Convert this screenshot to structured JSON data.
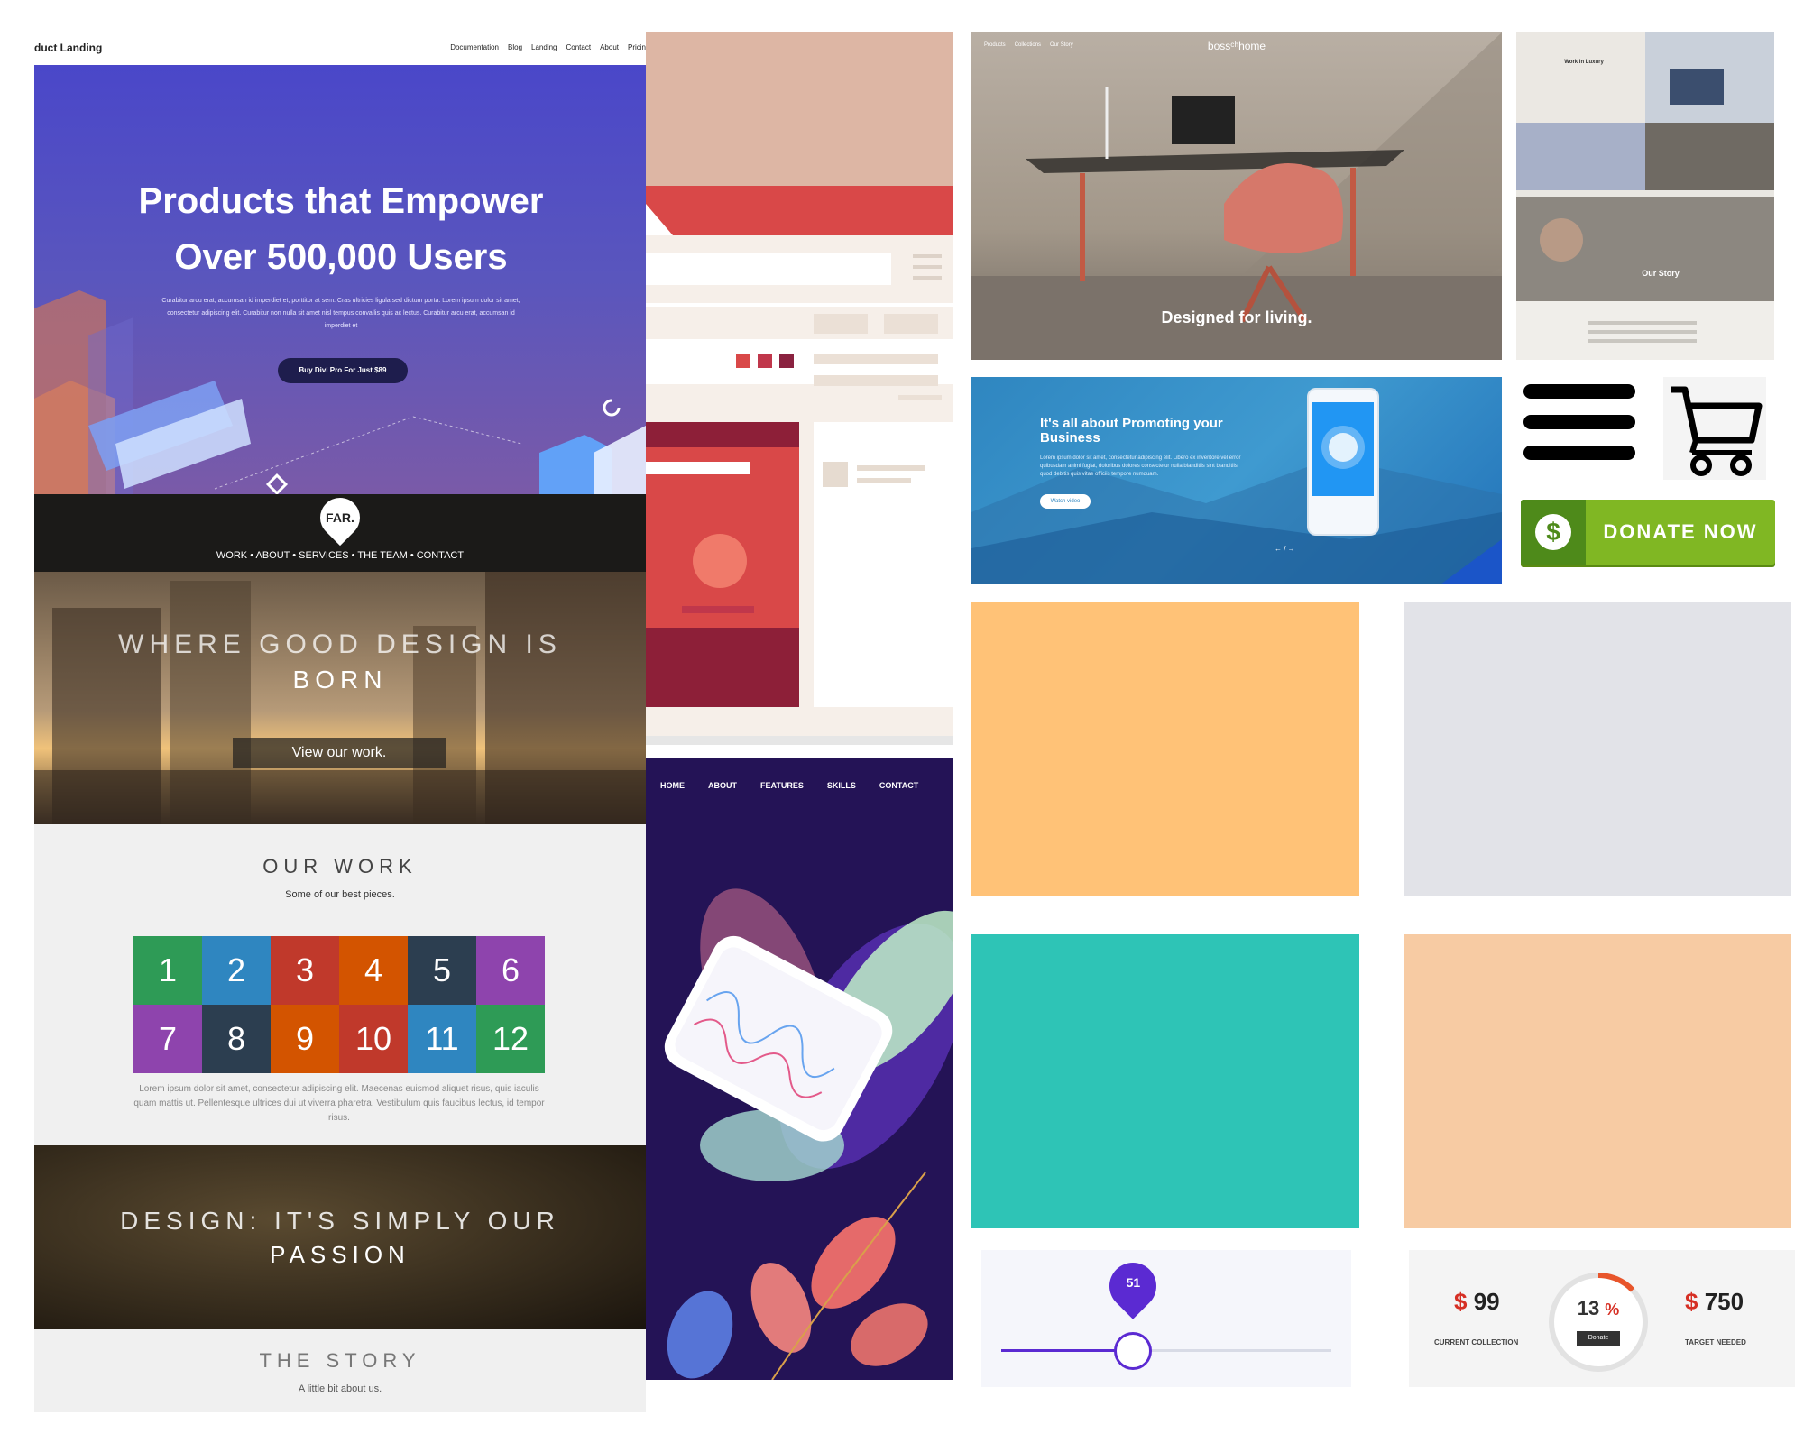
{
  "landing": {
    "brand": "duct Landing",
    "nav": [
      "Documentation",
      "Blog",
      "Landing",
      "Contact",
      "About",
      "Pricin"
    ],
    "headline_line1": "Products that Empower",
    "headline_line2": "Over 500,000 Users",
    "body": "Curabitur arcu erat, accumsan id imperdiet et, porttitor at sem. Cras ultricies ligula sed dictum porta. Lorem ipsum dolor sit amet, consectetur adipiscing elit. Curabitur non nulla sit amet nisl tempus convallis quis ac lectus. Curabitur arcu erat, accumsan id imperdiet et",
    "cta": "Buy Divi Pro For Just $89"
  },
  "far": {
    "logo": "FAR.",
    "menu": "WORK  •  ABOUT  •  SERVICES  •  THE TEAM  •  CONTACT",
    "hero_line1": "WHERE GOOD DESIGN IS",
    "hero_line2": "BORN",
    "view_button": "View our work.",
    "our_work": "OUR WORK",
    "our_work_sub": "Some of our best pieces.",
    "tiles": [
      {
        "n": "1",
        "color": "#2e9b56"
      },
      {
        "n": "2",
        "color": "#2f86c0"
      },
      {
        "n": "3",
        "color": "#c0392b"
      },
      {
        "n": "4",
        "color": "#d35400"
      },
      {
        "n": "5",
        "color": "#2c3e50"
      },
      {
        "n": "6",
        "color": "#8e44ad"
      },
      {
        "n": "7",
        "color": "#8e44ad"
      },
      {
        "n": "8",
        "color": "#2c3e50"
      },
      {
        "n": "9",
        "color": "#d35400"
      },
      {
        "n": "10",
        "color": "#c0392b"
      },
      {
        "n": "11",
        "color": "#2f86c0"
      },
      {
        "n": "12",
        "color": "#2e9b56"
      }
    ],
    "lorem": "Lorem ipsum dolor sit amet, consectetur adipiscing elit. Maecenas euismod aliquet risus, quis iaculis quam mattis ut. Pellentesque ultrices dui ut viverra pharetra. Vestibulum quis faucibus lectus, id tempor risus.",
    "design_line1": "DESIGN: IT'S SIMPLY OUR",
    "design_line2": "PASSION",
    "story": "THE STORY",
    "story_sub": "A little bit about us."
  },
  "app": {
    "nav": [
      "HOME",
      "ABOUT",
      "FEATURES",
      "SKILLS",
      "CONTACT"
    ]
  },
  "boss": {
    "logo": "bossᶜʰhome",
    "nav": [
      "Products",
      "Collections",
      "Our Story"
    ],
    "tagline": "Designed for living."
  },
  "luxury": {
    "heading": "Work in Luxury",
    "story": "Our Story"
  },
  "promo": {
    "title": "It's all about Promoting your Business",
    "body": "Lorem ipsum dolor sit amet, consectetur adipiscing elit. Libero ex inventore vel error quibusdam animi fugiat, doloribus dolores consectetur nulla blanditiis sint blanditiis quod debitis quis vitae officiis tempore numquam.",
    "button": "Watch video"
  },
  "donate": {
    "label": "DONATE NOW",
    "symbol": "$"
  },
  "swatches": {
    "orange": "#ffc277",
    "grey": "#e2e3e8",
    "teal": "#2ec4b6",
    "peach": "#f7cba3"
  },
  "slider": {
    "value": "51",
    "fraction": 0.4
  },
  "fund": {
    "current_symbol": "$",
    "current": "99",
    "current_label": "CURRENT COLLECTION",
    "percent": "13",
    "percent_symbol": "%",
    "donate": "Donate",
    "target_symbol": "$",
    "target": "750",
    "target_label": "TARGET NEEDED",
    "progress": 0.13
  }
}
